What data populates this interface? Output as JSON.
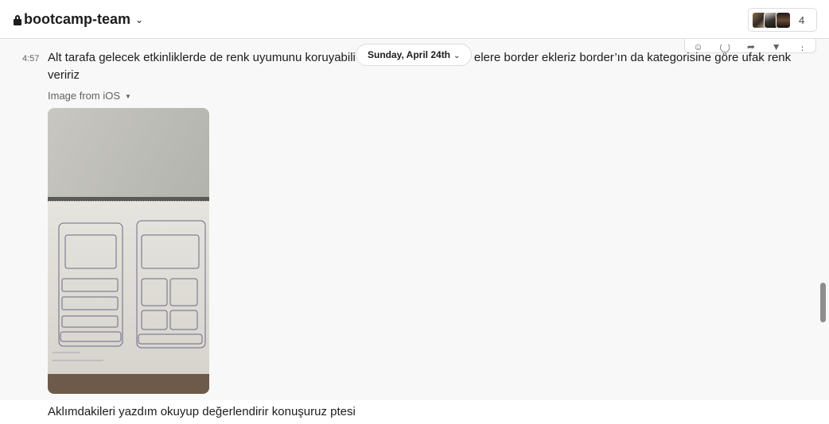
{
  "header": {
    "channel_name": "bootcamp-team",
    "member_count": "4"
  },
  "date_divider": {
    "label": "Sunday, April 24th"
  },
  "messages": [
    {
      "time": "4:57",
      "text_before": "Alt tarafa gelecek etkinliklerde de renk uyumunu koruyabili",
      "text_after": "elere border ekleriz border’ın da kategorisine göre ufak renk veririz",
      "attachment_label": "Image from iOS"
    },
    {
      "text": "Aklımdakileri yazdım okuyup değerlendirir konuşuruz ptesi"
    }
  ],
  "colors": {
    "background": "#f8f8f8",
    "header_bg": "#ffffff",
    "text": "#1d1c1d",
    "muted": "#616061"
  }
}
